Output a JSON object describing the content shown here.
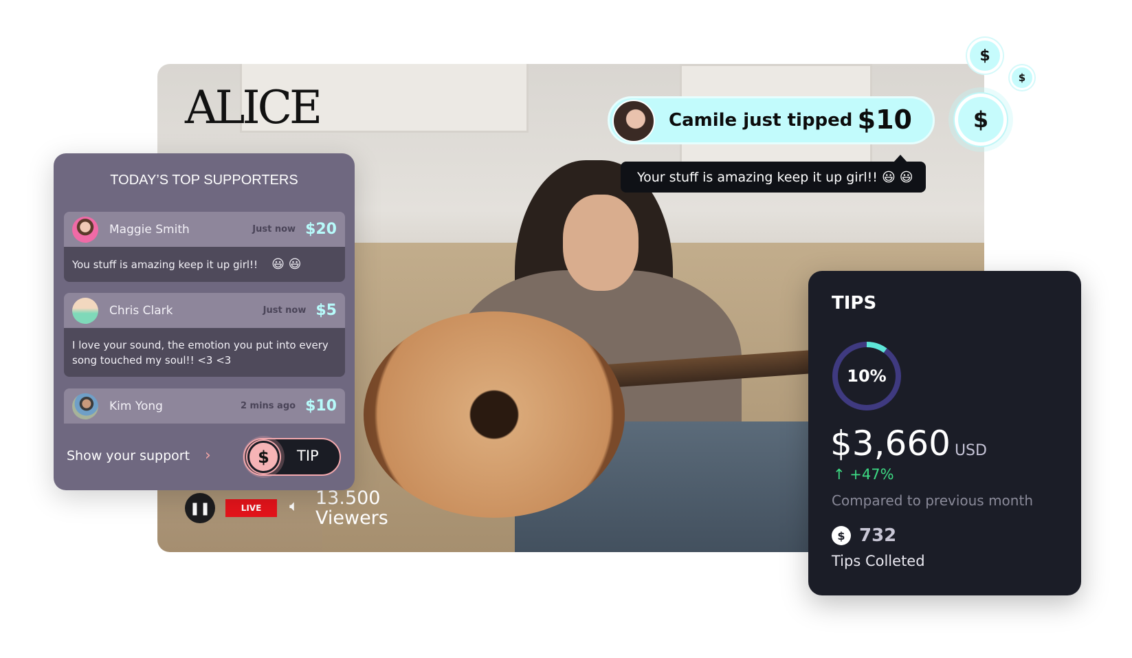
{
  "stream": {
    "logo": "ALICE",
    "live_label": "LIVE",
    "viewers_count": "13.500",
    "viewers_label": "Viewers"
  },
  "supporters": {
    "title": "TODAY’S TOP SUPPORTERS",
    "items": [
      {
        "name": "Maggie Smith",
        "time": "Just now",
        "amount": "$20",
        "message": "You stuff is amazing keep it up girl!!",
        "emoji": "😃 😃"
      },
      {
        "name": "Chris Clark",
        "time": "Just now",
        "amount": "$5",
        "message": "I love your sound, the emotion you put into every song touched my soul!!  <3 <3"
      },
      {
        "name": "Kim Yong",
        "time": "2 mins ago",
        "amount": "$10"
      }
    ],
    "support_label": "Show your support",
    "chevron": "›",
    "tip_button": "TIP",
    "coin_symbol": "$"
  },
  "notification": {
    "text": "Camile just tipped",
    "amount": "$10",
    "message": "Your stuff is amazing keep it up girl!! 😃 😃"
  },
  "tips": {
    "title": "TIPS",
    "progress_percent": 10,
    "progress_label": "10%",
    "amount": "$3,660",
    "currency": "USD",
    "change": "+47%",
    "compared": "Compared to previous month",
    "count": "732",
    "count_label": "Tips Colleted"
  },
  "colors": {
    "accent_cyan": "#c2fbfc",
    "ring_track": "#3f3a80",
    "ring_fill": "#5ee6d8",
    "positive": "#3ddc84",
    "live": "#e5141b",
    "tip_pink": "#f4a9ae"
  }
}
